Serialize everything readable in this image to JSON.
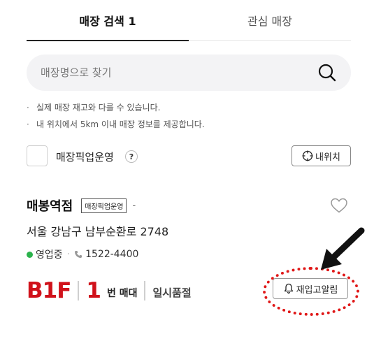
{
  "tabs": [
    {
      "label": "매장 검색 1",
      "active": true
    },
    {
      "label": "관심 매장",
      "active": false
    }
  ],
  "search": {
    "placeholder": "매장명으로 찾기",
    "icon": "search-icon"
  },
  "notices": [
    "실제 매장 재고와 다를 수 있습니다.",
    "내 위치에서 5km 이내 매장 정보를 제공합니다."
  ],
  "filter": {
    "label": "매장픽업운영",
    "help": "?",
    "checked": false,
    "myloc_label": "내위치"
  },
  "store": {
    "name": "매봉역점",
    "badge": "매장픽업운영",
    "dash": "-",
    "address": "서울 강남구 남부순환로 2748",
    "status": "영업중",
    "phone": "1522-4400",
    "floor": "B1F",
    "shelf_number": "1",
    "shelf_unit": "번 매대",
    "stock_status": "일시품절",
    "restock_label": "재입고알림"
  },
  "colors": {
    "accent_red": "#d0121b",
    "status_green": "#2bb24c",
    "annotation_red": "#e01818"
  }
}
